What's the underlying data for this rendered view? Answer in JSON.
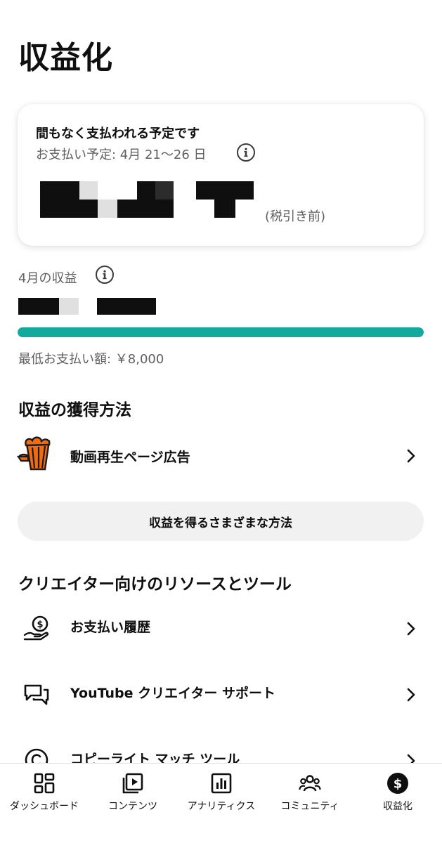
{
  "header": {
    "title": "収益化"
  },
  "payout": {
    "heading": "間もなく支払われる予定です",
    "date_text": "お支払い予定: 4月 21〜26 日",
    "pretax_label": "(税引き前)"
  },
  "month": {
    "label": "4月の収益",
    "progress": 1.0,
    "min_payout_text": "最低お支払い額: ￥8,000"
  },
  "earn_section": {
    "title": "収益の獲得方法",
    "ads_label": "動画再生ページ広告",
    "methods_button": "収益を得るさまざまな方法"
  },
  "resources_section": {
    "title": "クリエイター向けのリソースとツール",
    "items": [
      {
        "label": "お支払い履歴",
        "icon": "payment-history-icon"
      },
      {
        "label": "YouTube クリエイター サポート",
        "icon": "support-chat-icon"
      },
      {
        "label": "コピーライト マッチ ツール",
        "icon": "copyright-icon"
      }
    ]
  },
  "nav": {
    "items": [
      {
        "label": "ダッシュボード",
        "icon": "dashboard-icon"
      },
      {
        "label": "コンテンツ",
        "icon": "content-icon"
      },
      {
        "label": "アナリティクス",
        "icon": "analytics-icon"
      },
      {
        "label": "コミュニティ",
        "icon": "community-icon"
      },
      {
        "label": "収益化",
        "icon": "monetization-icon",
        "active": true
      }
    ]
  },
  "colors": {
    "accent_progress": "#13a99d",
    "popcorn_orange": "#f26b10",
    "text_primary": "#0f0f0f",
    "text_secondary": "#606060"
  }
}
